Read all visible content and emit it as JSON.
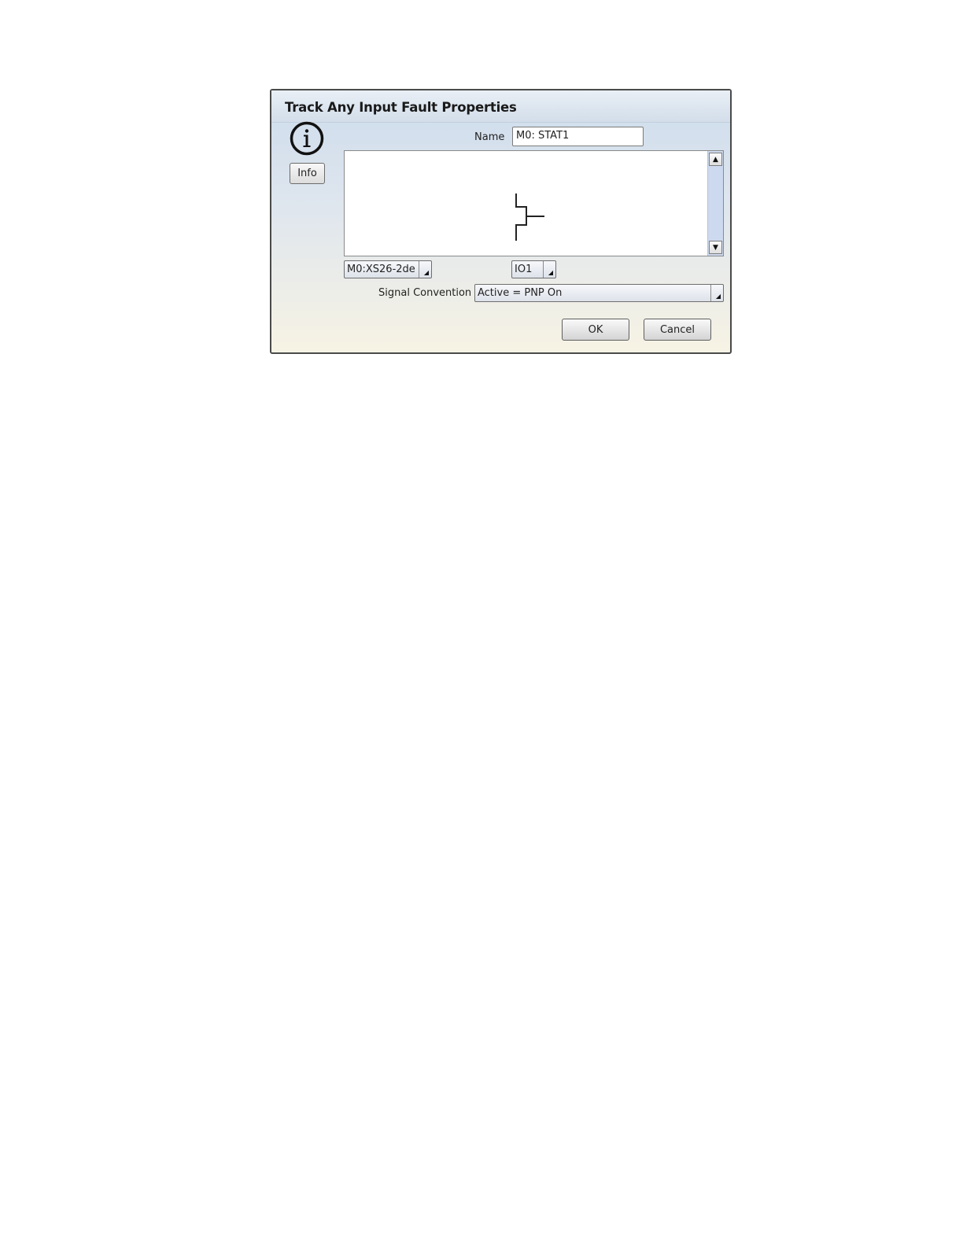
{
  "dialog": {
    "title": "Track Any Input Fault Properties",
    "info_button_label": "Info",
    "info_icon": "info-icon",
    "name_label": "Name",
    "name_value": "M0: STAT1",
    "module_select_value": "M0:XS26-2de",
    "io_select_value": "IO1",
    "signal_convention_label": "Signal Convention",
    "signal_convention_value": "Active = PNP On",
    "ok_label": "OK",
    "cancel_label": "Cancel",
    "scroll_up_icon": "scroll-up-icon",
    "scroll_down_icon": "scroll-down-icon",
    "contact_symbol_icon": "input-contact-symbol-icon",
    "dropdown_icon": "dropdown-arrow-icon"
  },
  "colors": {
    "title_gradient_top": "#cddcec",
    "body_gradient_bottom": "#f7f3e4",
    "scrollbar_track": "#cdd9ee"
  }
}
